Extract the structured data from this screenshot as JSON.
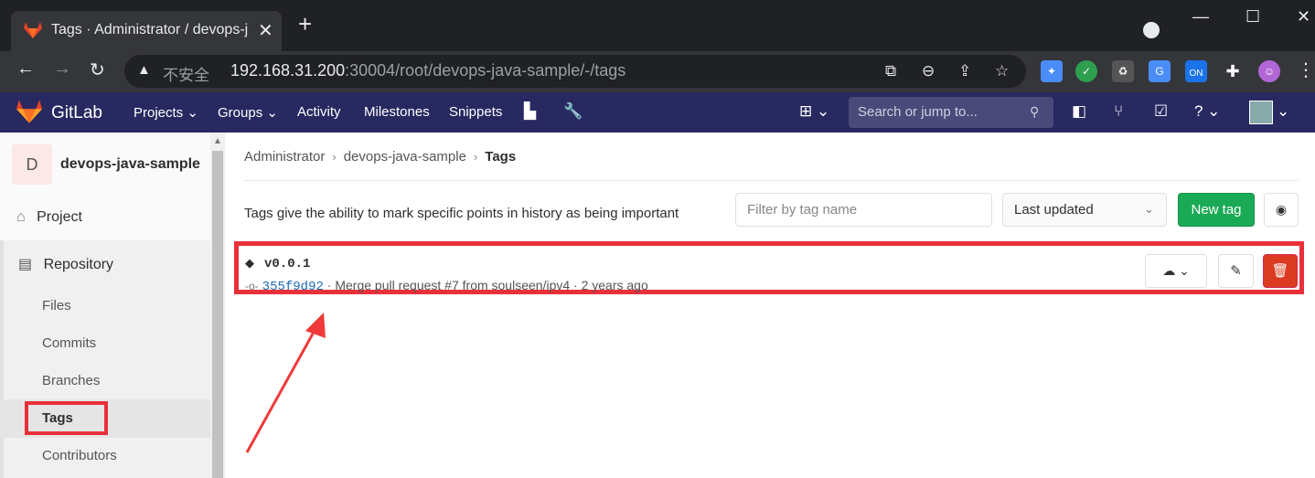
{
  "browser": {
    "tab_title": "Tags · Administrator / devops-j",
    "tab_close": "✕",
    "new_tab": "+",
    "insecure_label": "不安全",
    "url_host": "192.168.31.200",
    "url_rest": ":30004/root/devops-java-sample/-/tags",
    "extension_on_label": "ON"
  },
  "gitlab_nav": {
    "brand": "GitLab",
    "items": [
      "Projects",
      "Groups",
      "Activity",
      "Milestones",
      "Snippets"
    ],
    "search_placeholder": "Search or jump to..."
  },
  "sidebar": {
    "project_initial": "D",
    "project_name": "devops-java-sample",
    "project_label": "Project",
    "repository_label": "Repository",
    "sub_items": [
      "Files",
      "Commits",
      "Branches",
      "Tags",
      "Contributors"
    ]
  },
  "breadcrumb": {
    "items": [
      "Administrator",
      "devops-java-sample",
      "Tags"
    ]
  },
  "toolbar": {
    "description": "Tags give the ability to mark specific points in history as being important",
    "filter_placeholder": "Filter by tag name",
    "sort_label": "Last updated",
    "new_tag_label": "New tag"
  },
  "tags": [
    {
      "name": "v0.0.1",
      "sha": "355f9d92",
      "message": "· Merge pull request #7 from soulseen/ipv4 · 2 years ago"
    }
  ],
  "colors": {
    "nav_bg": "#292961",
    "new_tag_green": "#1aaa55",
    "delete_red": "#db3b21",
    "highlight_red": "#e8303a"
  }
}
